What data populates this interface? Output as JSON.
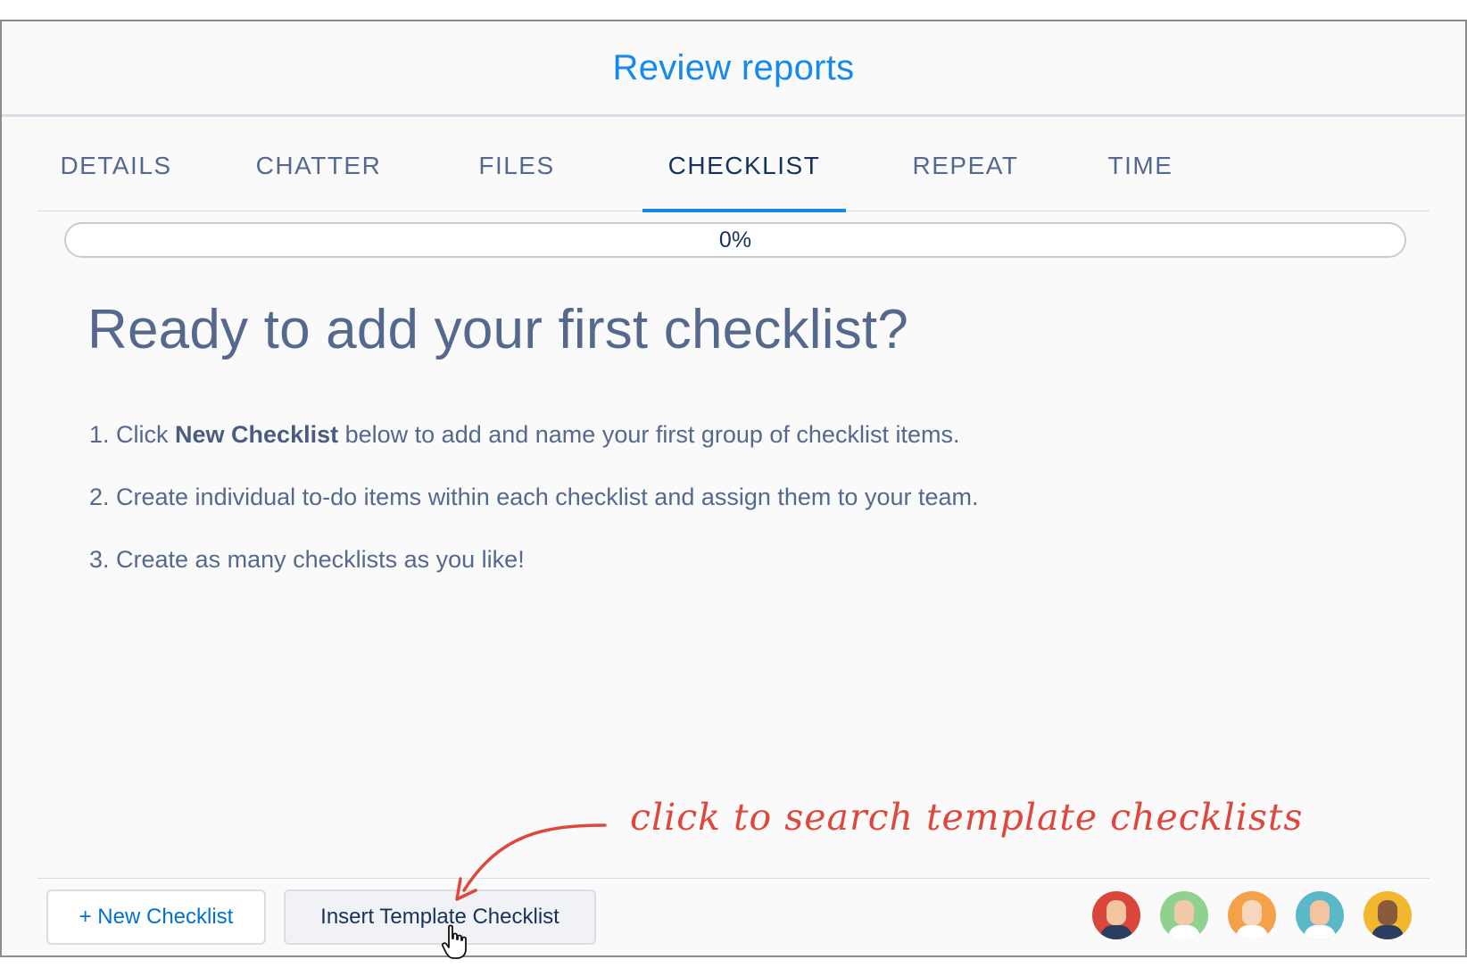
{
  "header": {
    "title": "Review reports"
  },
  "tabs": [
    {
      "label": "DETAILS",
      "active": false
    },
    {
      "label": "CHATTER",
      "active": false
    },
    {
      "label": "FILES",
      "active": false
    },
    {
      "label": "CHECKLIST",
      "active": true
    },
    {
      "label": "REPEAT",
      "active": false
    },
    {
      "label": "TIME",
      "active": false
    }
  ],
  "progress": {
    "label": "0%",
    "value": 0
  },
  "empty_state": {
    "heading": "Ready to add your first checklist?",
    "step1": {
      "prefix": "1. Click ",
      "bold": "New Checklist",
      "suffix": " below to add and name your first group of checklist items."
    },
    "step2": "2. Create individual to-do items within each checklist and assign them to your team.",
    "step3": "3. Create as many checklists as you like!"
  },
  "footer": {
    "new_checklist_label": "+ New Checklist",
    "insert_template_label": "Insert Template Checklist",
    "avatars": [
      {
        "icon": "avatar-red",
        "bg": "#d9463b",
        "skin": "#f2c4a0",
        "shirt": "#2a3f5f"
      },
      {
        "icon": "avatar-green",
        "bg": "#8fd18f",
        "skin": "#f2c9a8",
        "shirt": "#ffffff"
      },
      {
        "icon": "avatar-orange",
        "bg": "#f5a14b",
        "skin": "#f7d6bd",
        "shirt": "#ffffff"
      },
      {
        "icon": "avatar-teal",
        "bg": "#5ab8c9",
        "skin": "#f2c4a0",
        "shirt": "#ffffff"
      },
      {
        "icon": "avatar-yellow",
        "bg": "#f3b72f",
        "skin": "#8a5a3c",
        "shirt": "#2a3f5f"
      }
    ]
  },
  "annotation": {
    "text": "click to search template checklists",
    "color": "#e0473c"
  },
  "colors": {
    "accent": "#1589ee",
    "text": "#54698d",
    "progress": "#4bca81"
  }
}
